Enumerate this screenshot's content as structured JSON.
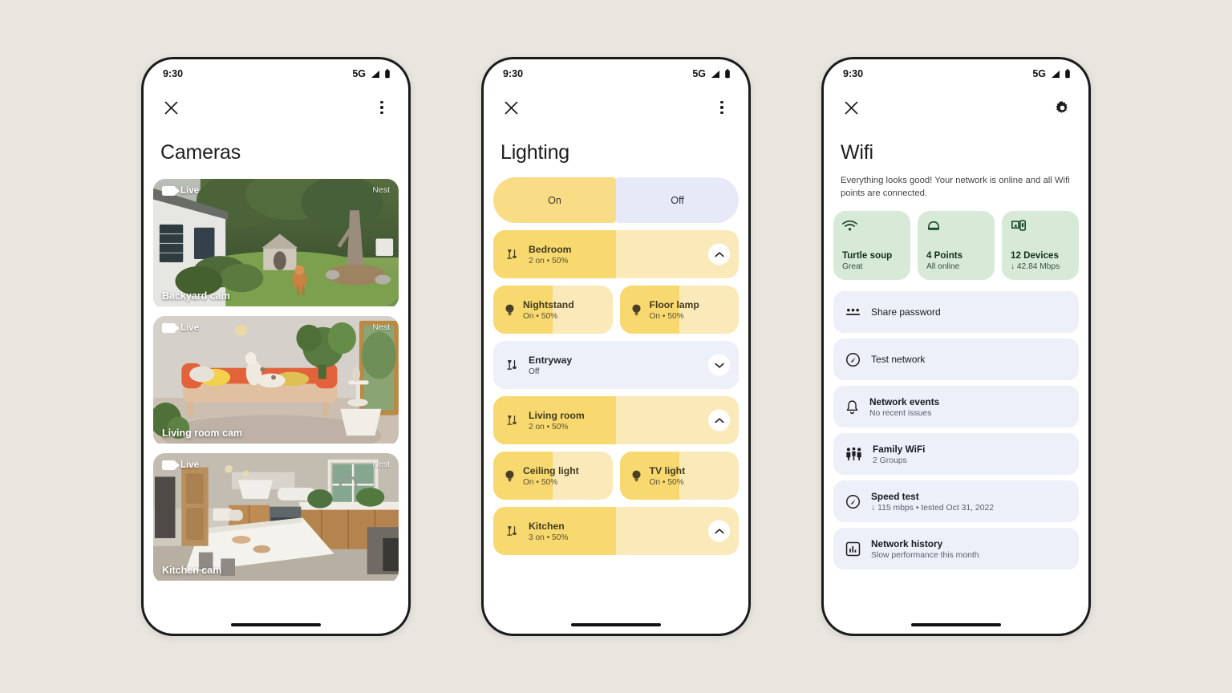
{
  "statusbar": {
    "time": "9:30",
    "network": "5G"
  },
  "phones": {
    "cameras": {
      "title": "Cameras",
      "close_label": "Close",
      "overflow_label": "More options",
      "items": [
        {
          "name": "Backyard cam",
          "live": "Live",
          "brand": "Nest"
        },
        {
          "name": "Living room cam",
          "live": "Live",
          "brand": "Nest"
        },
        {
          "name": "Kitchen cam",
          "live": "Live",
          "brand": "Nest"
        }
      ]
    },
    "lighting": {
      "title": "Lighting",
      "close_label": "Close",
      "overflow_label": "More options",
      "toggle": {
        "on": "On",
        "off": "Off",
        "selected": "On"
      },
      "groups": [
        {
          "name": "Bedroom",
          "status": "2 on • 50%",
          "state": "on",
          "level": 50,
          "expanded": true,
          "lights": [
            {
              "name": "Nightstand",
              "status": "On • 50%",
              "level": 50
            },
            {
              "name": "Floor lamp",
              "status": "On • 50%",
              "level": 50
            }
          ]
        },
        {
          "name": "Entryway",
          "status": "Off",
          "state": "off",
          "level": 0,
          "expanded": false,
          "lights": []
        },
        {
          "name": "Living room",
          "status": "2 on • 50%",
          "state": "on",
          "level": 50,
          "expanded": true,
          "lights": [
            {
              "name": "Ceiling light",
              "status": "On • 50%",
              "level": 50
            },
            {
              "name": "TV light",
              "status": "On • 50%",
              "level": 50
            }
          ]
        },
        {
          "name": "Kitchen",
          "status": "3 on • 50%",
          "state": "on",
          "level": 50,
          "expanded": true,
          "lights": []
        }
      ]
    },
    "wifi": {
      "title": "Wifi",
      "close_label": "Close",
      "settings_label": "Settings",
      "description": "Everything looks good! Your network is online and all Wifi points are connected.",
      "stats": [
        {
          "icon": "wifi-icon",
          "title": "Turtle soup",
          "subtitle": "Great"
        },
        {
          "icon": "router-icon",
          "title": "4 Points",
          "subtitle": "All online"
        },
        {
          "icon": "devices-icon",
          "title": "12 Devices",
          "subtitle": "↓ 42.84 Mbps"
        }
      ],
      "items": [
        {
          "icon": "password-icon",
          "title": "Share password",
          "subtitle": ""
        },
        {
          "icon": "speedometer-icon",
          "title": "Test network",
          "subtitle": ""
        },
        {
          "icon": "bell-icon",
          "title": "Network events",
          "subtitle": "No recent issues"
        },
        {
          "icon": "family-icon",
          "title": "Family WiFi",
          "subtitle": "2 Groups"
        },
        {
          "icon": "speedometer-icon",
          "title": "Speed test",
          "subtitle": "↓ 115 mbps • tested Oct 31, 2022"
        },
        {
          "icon": "history-icon",
          "title": "Network history",
          "subtitle": "Slow performance this month"
        }
      ]
    }
  },
  "colors": {
    "page_background": "#e9e6e0",
    "light_on": "#f7d96f",
    "light_track": "#fbeab9",
    "light_off": "#eef0f9",
    "green_card": "#d7ead8",
    "accent_text": "#433a1f"
  }
}
